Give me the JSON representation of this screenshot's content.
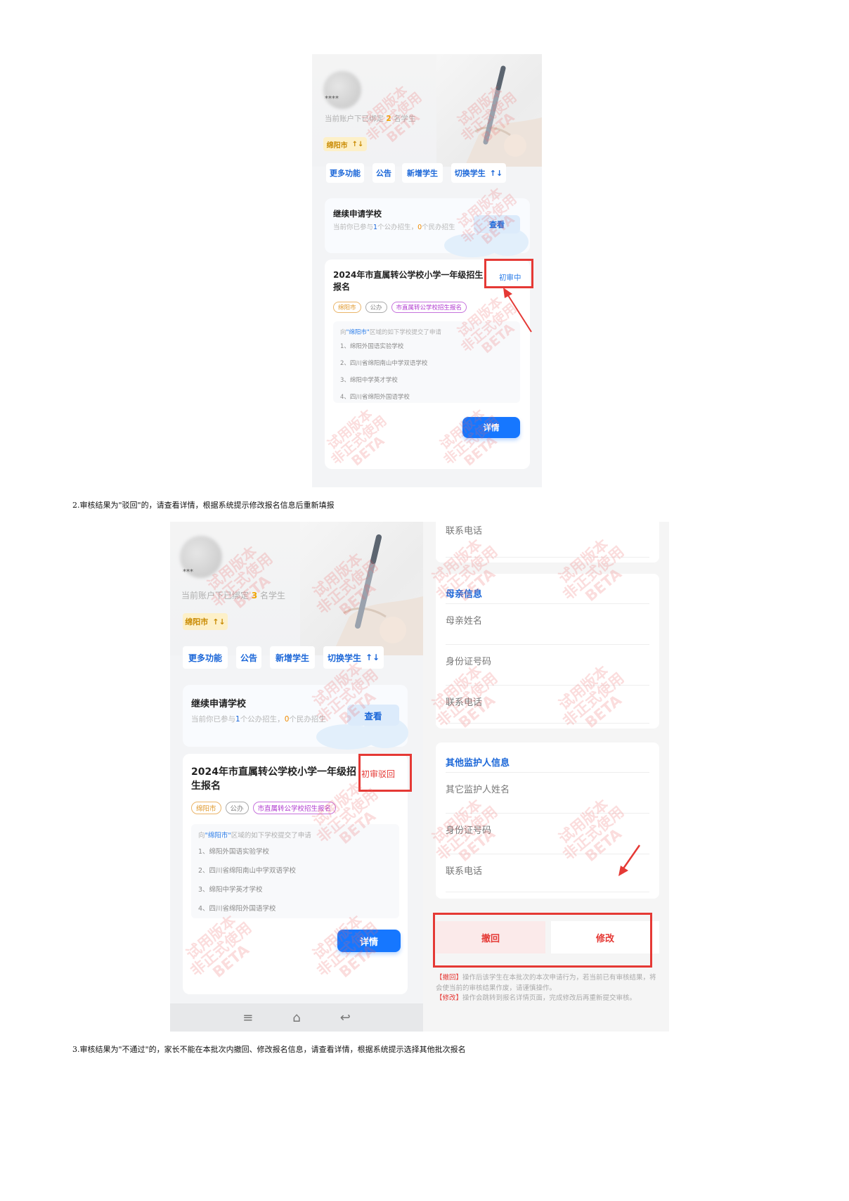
{
  "watermark": {
    "line1": "试用版本",
    "line2": "非正式使用",
    "line3": "BETA"
  },
  "shot1": {
    "masked_name": "****",
    "bound_prefix": "当前账户下已绑定",
    "bound_count": "2",
    "bound_suffix": "名学生",
    "city": "绵阳市",
    "switch_icon": "↑↓",
    "actions": [
      "更多功能",
      "公告",
      "新增学生",
      "切换学生"
    ],
    "continue": {
      "title": "继续申请学校",
      "sub_a": "当前你已参与",
      "sub_n1": "1",
      "sub_b": "个公办招生，",
      "sub_n2": "0",
      "sub_c": "个民办招生",
      "button": "查看"
    },
    "app": {
      "title": "2024年市直属转公学校小学一年级招生报名",
      "status": "初审中",
      "tags": [
        "绵阳市",
        "公办",
        "市直属转公学校招生报名"
      ],
      "schools_head_a": "向",
      "schools_head_city": "\"绵阳市\"",
      "schools_head_b": "区域的如下学校提交了申请",
      "schools": [
        "1、绵阳外国语实验学校",
        "2、四川省绵阳南山中学双语学校",
        "3、绵阳中学英才学校",
        "4、四川省绵阳外国语学校"
      ],
      "detail": "详情"
    }
  },
  "caption2": "2.审核结果为\"驳回\"的，请查看详情，根据系统提示修改报名信息后重新填报",
  "shot2": {
    "masked_name": "***",
    "bound_prefix": "当前账户下已绑定",
    "bound_count": "3",
    "bound_suffix": "名学生",
    "city": "绵阳市",
    "switch_icon": "↑↓",
    "actions": [
      "更多功能",
      "公告",
      "新增学生",
      "切换学生"
    ],
    "continue": {
      "title": "继续申请学校",
      "sub_a": "当前你已参与",
      "sub_n1": "1",
      "sub_b": "个公办招生，",
      "sub_n2": "0",
      "sub_c": "个民办招生",
      "button": "查看"
    },
    "app": {
      "title": "2024年市直属转公学校小学一年级招生报名",
      "status": "初审驳回",
      "tags": [
        "绵阳市",
        "公办",
        "市直属转公学校招生报名"
      ],
      "schools_head_a": "向",
      "schools_head_city": "\"绵阳市\"",
      "schools_head_b": "区域的如下学校提交了申请",
      "schools": [
        "1、绵阳外国语实验学校",
        "2、四川省绵阳南山中学双语学校",
        "3、绵阳中学英才学校",
        "4、四川省绵阳外国语学校"
      ],
      "detail": "详情"
    },
    "nav_icons": [
      "≡",
      "⌂",
      "↩"
    ]
  },
  "shot3": {
    "top_field": "联系电话",
    "mother": {
      "title": "母亲信息",
      "fields": [
        "母亲姓名",
        "身份证号码",
        "联系电话"
      ]
    },
    "guardian": {
      "title": "其他监护人信息",
      "fields": [
        "其它监护人姓名",
        "身份证号码",
        "联系电话"
      ]
    },
    "recall": "撤回",
    "modify": "修改",
    "note_recall_key": "【撤回】",
    "note_recall": "操作后该学生在本批次的本次申请行为，若当前已有审核结果，将会使当前的审核结果作废，请谨慎操作。",
    "note_modify_key": "【修改】",
    "note_modify": "操作会跳转到报名详情页面，完成修改后再重新提交审核。"
  },
  "caption3": "3.审核结果为\"不通过\"的，家长不能在本批次内撤回、修改报名信息，请查看详情，根据系统提示选择其他批次报名"
}
